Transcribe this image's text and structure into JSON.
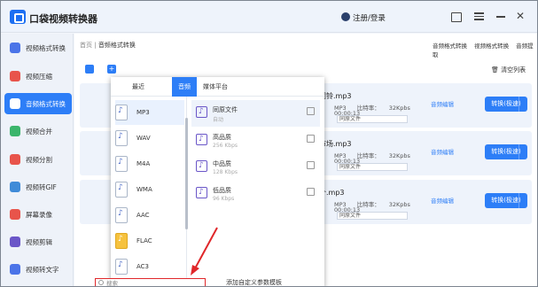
{
  "app": {
    "title": "口袋视频转换器",
    "login": "注册/登录"
  },
  "sidebar": {
    "items": [
      {
        "label": "视频格式转换",
        "color": "#4b74e8"
      },
      {
        "label": "视频压缩",
        "color": "#e8544b"
      },
      {
        "label": "音频格式转换",
        "color": "#ffffff",
        "active": true
      },
      {
        "label": "视频合并",
        "color": "#3bb56b"
      },
      {
        "label": "视频分割",
        "color": "#e8544b"
      },
      {
        "label": "视频转GIF",
        "color": "#3f8bd8"
      },
      {
        "label": "屏幕录像",
        "color": "#e8544b"
      },
      {
        "label": "视频剪辑",
        "color": "#6a56c8"
      },
      {
        "label": "视频转文字",
        "color": "#4b74e8"
      }
    ]
  },
  "main": {
    "breadcrumb_home": "首页",
    "breadcrumb_sep": "|",
    "breadcrumb_current": "音频格式转换",
    "top_links": [
      "音频格式转换",
      "视频格式转换",
      "音频提取"
    ],
    "clear_list": "清空列表",
    "rows": [
      {
        "name": "闹铃.mp3",
        "format": "MP3",
        "bitrate_label": "比特率：",
        "bitrate": "32Kpbs",
        "time": "00:00:13",
        "output_label": "同原文件",
        "edit": "音频编辑",
        "convert": "转换(极速)"
      },
      {
        "name": "市场.mp3",
        "format": "MP3",
        "bitrate_label": "比特率：",
        "bitrate": "32Kpbs",
        "time": "00:00:13",
        "output_label": "同原文件",
        "edit": "音频编辑",
        "convert": "转换(极速)"
      },
      {
        "name": "个.mp3",
        "format": "MP3",
        "bitrate_label": "比特率：",
        "bitrate": "32Kpbs",
        "time": "00:00:13",
        "output_label": "同原文件",
        "edit": "音频编辑",
        "convert": "转换(极速)"
      }
    ]
  },
  "popup": {
    "tabs": [
      "最近",
      "音频",
      "媒体平台"
    ],
    "formats": [
      "MP3",
      "WAV",
      "M4A",
      "WMA",
      "AAC",
      "FLAC",
      "AC3"
    ],
    "qualities": [
      {
        "name": "同原文件",
        "sub": "自动"
      },
      {
        "name": "高品质",
        "sub": "256 Kbps"
      },
      {
        "name": "中品质",
        "sub": "128 Kbps"
      },
      {
        "name": "低品质",
        "sub": "96 Kbps"
      }
    ],
    "search_placeholder": "搜索",
    "custom_template": "添加自定义参数模板"
  }
}
